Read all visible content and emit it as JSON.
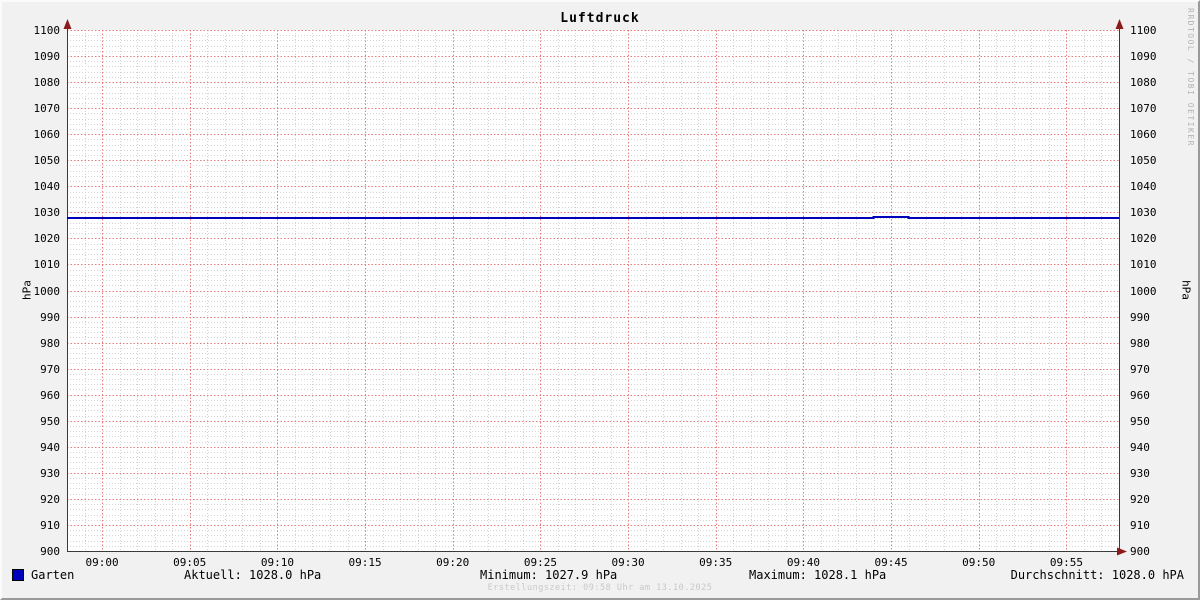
{
  "watermark": "RRDTOOL / TOBI OETIKER",
  "footer": {
    "creation_text": "Erstellungszeit: 09:58 Uhr am 13.10.2025"
  },
  "legend": {
    "series_label": "Garten",
    "series_color": "#0000bb",
    "stats": {
      "aktuell": "Aktuell: 1028.0 hPa",
      "minimum": "Minimum: 1027.9 hPa",
      "maximum": "Maximum: 1028.1 hPa",
      "durchschnitt": "Durchschnitt: 1028.0 hPA"
    }
  },
  "chart_data": {
    "type": "line",
    "title": "Luftdruck",
    "ylabel_left": "hPa",
    "ylabel_right": "hPa",
    "ylim": [
      900,
      1100
    ],
    "y_major_step": 10,
    "y_minor_step": 2,
    "y_tick_labels": [
      "900",
      "910",
      "920",
      "930",
      "940",
      "950",
      "960",
      "970",
      "980",
      "990",
      "1000",
      "1010",
      "1020",
      "1030",
      "1040",
      "1050",
      "1060",
      "1070",
      "1080",
      "1090",
      "1100"
    ],
    "x_start": "08:58",
    "x_end": "09:58",
    "x_tick_labels": [
      "09:00",
      "09:05",
      "09:10",
      "09:15",
      "09:20",
      "09:25",
      "09:30",
      "09:35",
      "09:40",
      "09:45",
      "09:50",
      "09:55"
    ],
    "x_minor_step_min": 1,
    "grid": true,
    "legend_position": "bottom",
    "series": [
      {
        "name": "Garten",
        "color": "#0000bb",
        "unit": "hPa",
        "points": [
          [
            "08:58",
            1028.0
          ],
          [
            "09:44",
            1028.0
          ],
          [
            "09:44",
            1028.1
          ],
          [
            "09:46",
            1028.1
          ],
          [
            "09:46",
            1028.0
          ],
          [
            "09:58",
            1028.0
          ]
        ]
      }
    ],
    "stats": {
      "aktuell": 1028.0,
      "minimum": 1027.9,
      "maximum": 1028.1,
      "durchschnitt": 1028.0,
      "unit": "hPa"
    },
    "colors": {
      "background": "#f1f1f1",
      "canvas": "#ffffff",
      "grid_major": "#e57d7d",
      "grid_minor": "#d3d3d3",
      "axis": "#3a3a3a",
      "arrow": "#8c1a1a",
      "font": "#000000"
    }
  }
}
